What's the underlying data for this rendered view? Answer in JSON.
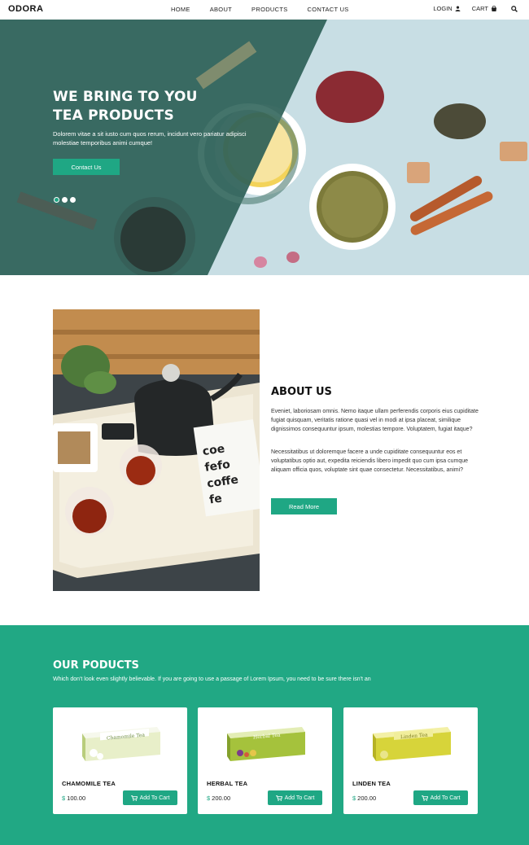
{
  "nav": {
    "logo": "ODORA",
    "menu": [
      "HOME",
      "ABOUT",
      "PRODUCTS",
      "CONTACT US"
    ],
    "login": "LOGIN",
    "cart": "CART"
  },
  "hero": {
    "title_line1": "WE BRING TO YOU",
    "title_line2": "TEA PRODUCTS",
    "text": "Dolorem vitae a sit iusto cum quos rerum, incidunt vero pariatur adipisci molestiae temporibus animi cumque!",
    "button": "Contact Us",
    "slides": 3,
    "active_slide": 1
  },
  "about": {
    "title": "ABOUT US",
    "p1": "Eveniet, laboriosam omnis. Nemo itaque ullam perferendis corporis eius cupiditate fugiat quisquam, veritatis ratione quasi vel in modi at ipsa placeat, similique dignissimos consequuntur ipsum, molestias tempore. Voluptatem, fugiat itaque?",
    "p2": "Necessitatibus ut doloremque facere a unde cupiditate consequuntur eos et voluptatibus optio aut, expedita reiciendis libero impedit quo cum ipsa cumque aliquam officia quos, voluptate sint quae consectetur. Necessitatibus, animi?",
    "button": "Read More",
    "card_text": [
      "coe",
      "fefo",
      "coffe",
      "fe"
    ]
  },
  "products": {
    "title": "OUR PODUCTS",
    "subtitle": "Which don't look even slightly believable. If you are going to use a passage of Lorem Ipsum, you need to be sure there isn't an",
    "items": [
      {
        "name": "CHAMOMILE TEA",
        "currency": "$",
        "price": "100.00",
        "button": "Add To Cart",
        "box_label": "Chamomile Tea",
        "color": "#e8efc9"
      },
      {
        "name": "HERBAL TEA",
        "currency": "$",
        "price": "200.00",
        "button": "Add To Cart",
        "box_label": "Herbal Tea",
        "color": "#a5c23c"
      },
      {
        "name": "LINDEN TEA",
        "currency": "$",
        "price": "200.00",
        "button": "Add To Cart",
        "box_label": "Linden Tea",
        "color": "#d7d43a"
      }
    ]
  },
  "colors": {
    "accent": "#1fa784",
    "products_bg": "#21a884",
    "hero_dark": "#2c5e57",
    "hero_light": "#c9dde2"
  }
}
